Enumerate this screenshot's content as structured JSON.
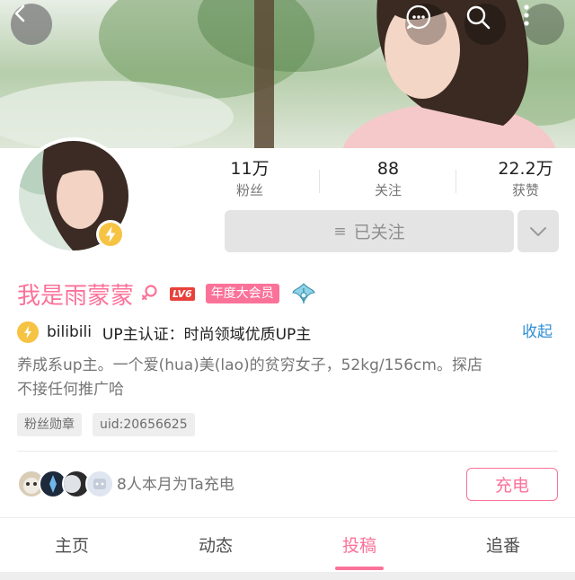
{
  "topbar": {
    "back_icon": "chevron-left-icon",
    "actions": [
      "message-icon",
      "search-icon",
      "more-vertical-icon"
    ]
  },
  "profile": {
    "name": "我是雨蒙蒙",
    "gender_icon": "female-icon",
    "level": "LV6",
    "vip_label": "年度大会员",
    "pendant_icon": "ribbon-pendant-icon",
    "verify_brand": "bilibili",
    "verify_text": "UP主认证：时尚领域优质UP主",
    "collapse_label": "收起",
    "bio_line1": "养成系up主。一个爱(hua)美(lao)的贫穷女子，52kg/156cm。探店",
    "bio_line2": "不接任何推广哈"
  },
  "stats": [
    {
      "value": "11万",
      "label": "粉丝"
    },
    {
      "value": "88",
      "label": "关注"
    },
    {
      "value": "22.2万",
      "label": "获赞"
    }
  ],
  "follow": {
    "label": "已关注",
    "lines_glyph": "≡"
  },
  "tags": [
    "粉丝勋章",
    "uid:20656625"
  ],
  "charge": {
    "text": "8人本月为Ta充电",
    "button_label": "充电"
  },
  "tabs": [
    {
      "label": "主页"
    },
    {
      "label": "动态"
    },
    {
      "label": "投稿"
    },
    {
      "label": "追番"
    }
  ],
  "active_tab": "投稿",
  "colors": {
    "accent_pink": "#fb7299",
    "link_blue": "#2f8fd4",
    "level_red": "#e8413b",
    "badge_yellow": "#f6c343"
  }
}
